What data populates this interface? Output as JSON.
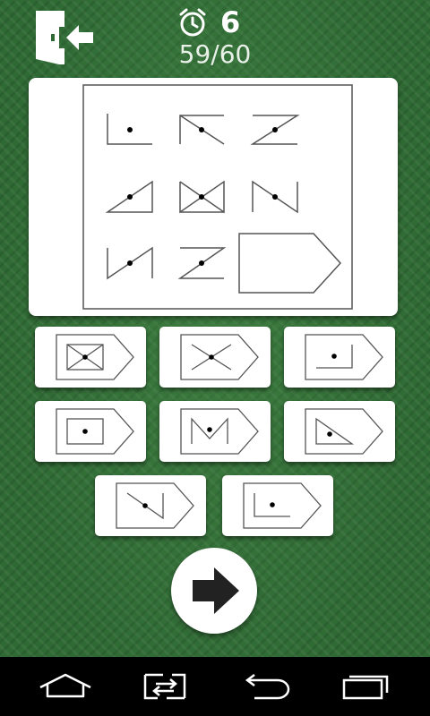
{
  "header": {
    "timer_icon": "stopwatch-icon",
    "timer_value": "6",
    "progress": "59/60",
    "exit_icon": "exit-door-icon"
  },
  "puzzle": {
    "cells": [
      "corner-dot-left",
      "diagonal-dot-top",
      "z-dot-top",
      "triangle-dot-left",
      "hourglass-dot",
      "n-dot",
      "n-dot-flip",
      "z-dot",
      "missing-answer-shape"
    ]
  },
  "options": [
    "envelope-box-dot",
    "x-shape-dot",
    "right-bracket-dot",
    "box-dot",
    "m-shape-dot",
    "triangle-dot",
    "diagonal-bracket-dot",
    "corner-dot"
  ],
  "next_icon": "arrow-right-icon",
  "nav": [
    "home-icon",
    "switch-icon",
    "back-icon",
    "recent-apps-icon"
  ],
  "colors": {
    "background": "#2f6a34",
    "panel": "#ffffff",
    "line": "#555555"
  }
}
